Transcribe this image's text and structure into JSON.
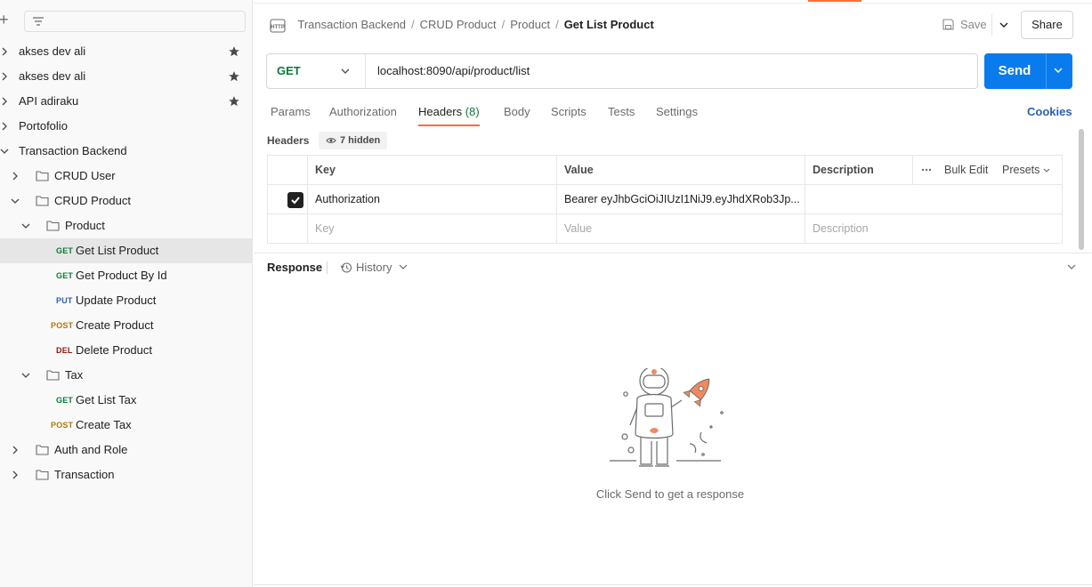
{
  "sidebar": {
    "filter_icon": "filter-icon",
    "items": [
      {
        "label": "akses dev ali",
        "starred": true
      },
      {
        "label": "akses dev ali",
        "starred": true
      },
      {
        "label": "API adiraku",
        "starred": true
      },
      {
        "label": "Portofolio"
      },
      {
        "label": "Transaction Backend"
      },
      {
        "label": "CRUD User"
      },
      {
        "label": "CRUD Product"
      },
      {
        "label": "Product"
      },
      {
        "label": "Get List Product",
        "method": "GET"
      },
      {
        "label": "Get Product By Id",
        "method": "GET"
      },
      {
        "label": "Update Product",
        "method": "PUT"
      },
      {
        "label": "Create Product",
        "method": "POST"
      },
      {
        "label": "Delete Product",
        "method": "DEL"
      },
      {
        "label": "Tax"
      },
      {
        "label": "Get List Tax",
        "method": "GET"
      },
      {
        "label": "Create Tax",
        "method": "POST"
      },
      {
        "label": "Auth and Role"
      },
      {
        "label": "Transaction"
      }
    ]
  },
  "breadcrumb": {
    "items": [
      "Transaction Backend",
      "CRUD Product",
      "Product"
    ],
    "current": "Get List Product",
    "separator": "/"
  },
  "toolbar": {
    "save_label": "Save",
    "share_label": "Share"
  },
  "request": {
    "method": "GET",
    "url": "localhost:8090/api/product/list",
    "send_label": "Send"
  },
  "tabs": {
    "items": [
      "Params",
      "Authorization",
      "Headers",
      "Body",
      "Scripts",
      "Tests",
      "Settings"
    ],
    "headers_count": "(8)",
    "active": "Headers",
    "cookies_label": "Cookies"
  },
  "headers_section": {
    "title": "Headers",
    "hidden_label": "7 hidden",
    "columns": {
      "key": "Key",
      "value": "Value",
      "description": "Description"
    },
    "bulk_edit_label": "Bulk Edit",
    "presets_label": "Presets",
    "rows": [
      {
        "checked": true,
        "key": "Authorization",
        "value": "Bearer eyJhbGciOiJIUzI1NiJ9.eyJhdXRob3Jp..."
      }
    ],
    "placeholders": {
      "key": "Key",
      "value": "Value",
      "description": "Description"
    }
  },
  "response": {
    "title": "Response",
    "history_label": "History",
    "empty_message": "Click Send to get a response"
  },
  "colors": {
    "accent": "#ff6c37",
    "send_button": "#097bed",
    "get": "#0b7a3b",
    "put": "#2d5fb8",
    "post": "#ad7a03",
    "del": "#8e1a10",
    "link": "#2d5fb8"
  }
}
